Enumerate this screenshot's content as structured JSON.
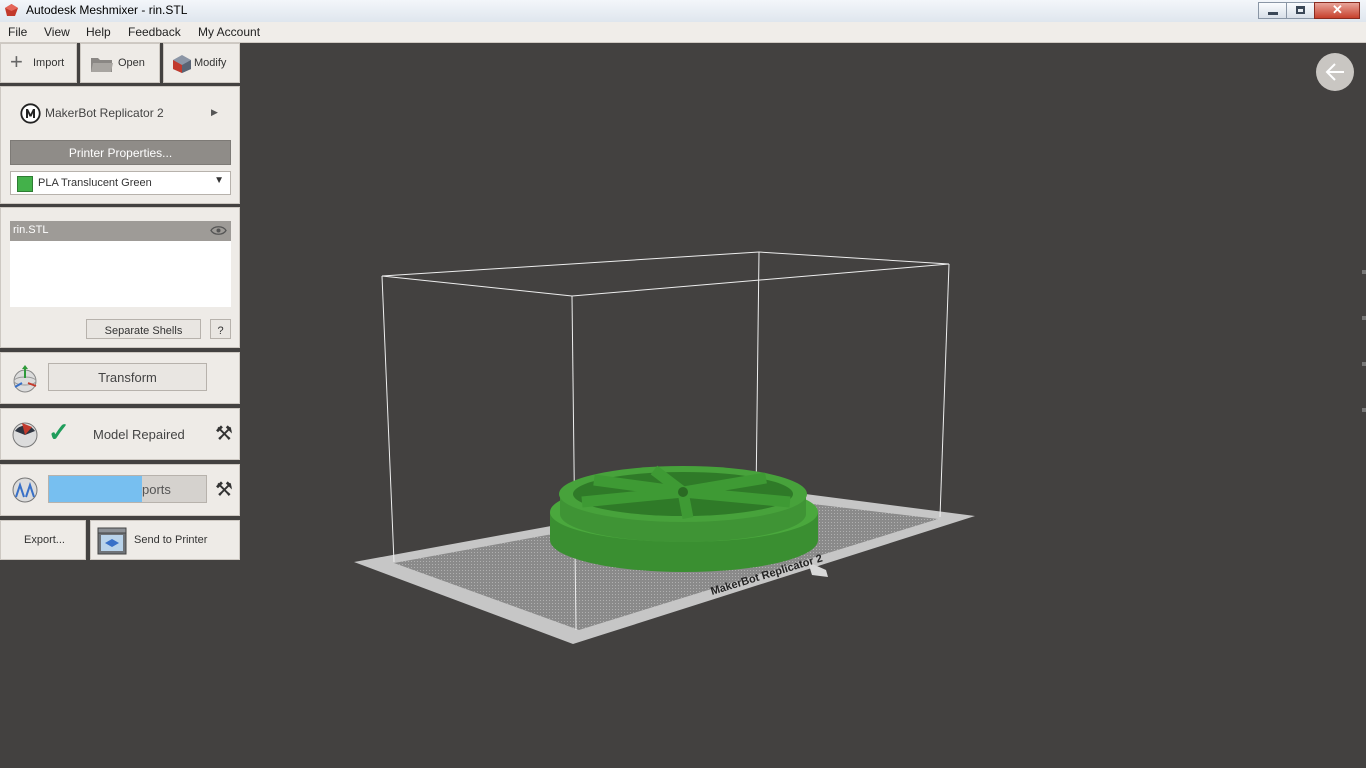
{
  "window": {
    "title": "Autodesk Meshmixer - rin.STL"
  },
  "menu": {
    "file": "File",
    "view": "View",
    "help": "Help",
    "feedback": "Feedback",
    "account": "My Account"
  },
  "toolbar": {
    "import": "Import",
    "open": "Open",
    "modify": "Modify"
  },
  "printer": {
    "name": "MakerBot Replicator 2",
    "properties_button": "Printer Properties...",
    "material": "PLA Translucent Green",
    "material_color": "#43b14a"
  },
  "objects": {
    "items": [
      {
        "name": "rin.STL"
      }
    ],
    "separate_shells": "Separate Shells",
    "help": "?"
  },
  "steps": {
    "transform": "Transform",
    "repair_status": "Model Repaired",
    "supports_label": "ports",
    "supports_progress": 0.59
  },
  "bottom": {
    "export": "Export...",
    "send": "Send to Printer"
  },
  "scene": {
    "bed_label": "MakerBot Replicator 2",
    "model_color": "#3f9a36"
  }
}
